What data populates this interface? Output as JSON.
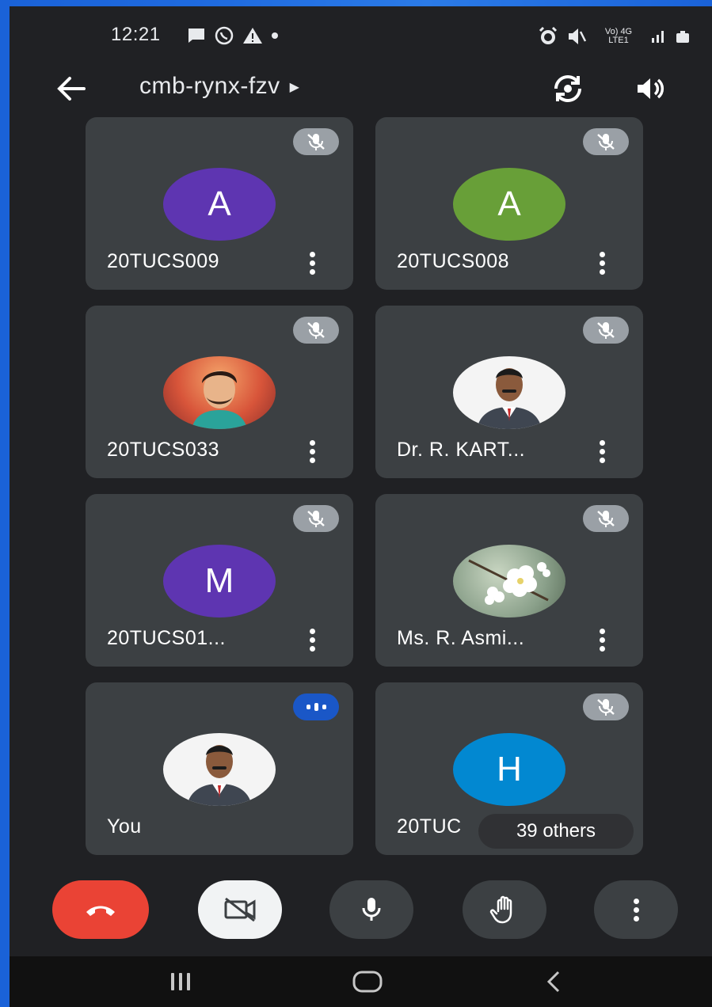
{
  "status_bar": {
    "time": "12:21",
    "network_label": "Vo) 4G LTE1"
  },
  "header": {
    "meeting_code": "cmb-rynx-fzv"
  },
  "participants": [
    {
      "name": "20TUCS009",
      "initial": "A",
      "avatar_color": "#5e35b1",
      "status": "muted"
    },
    {
      "name": "20TUCS008",
      "initial": "A",
      "avatar_color": "#689f38",
      "status": "muted"
    },
    {
      "name": "20TUCS033",
      "initial": "",
      "avatar_kind": "photo-illustrated-man",
      "status": "muted"
    },
    {
      "name": "Dr. R. KART...",
      "initial": "",
      "avatar_kind": "photo-man-suit",
      "status": "muted"
    },
    {
      "name": "20TUCS01...",
      "initial": "M",
      "avatar_color": "#5e35b1",
      "status": "muted"
    },
    {
      "name": "Ms. R. Asmi...",
      "initial": "",
      "avatar_kind": "photo-white-blossom",
      "status": "muted"
    },
    {
      "name": "You",
      "initial": "",
      "avatar_kind": "photo-man-suit",
      "status": "speaking"
    },
    {
      "name": "20TUC",
      "initial": "H",
      "avatar_color": "#0288d1",
      "status": "muted"
    }
  ],
  "others_pill": "39 others",
  "colors": {
    "background": "#202124",
    "tile": "#3c4043",
    "end_call": "#ea4335",
    "speaking_badge": "#1a57c7"
  }
}
